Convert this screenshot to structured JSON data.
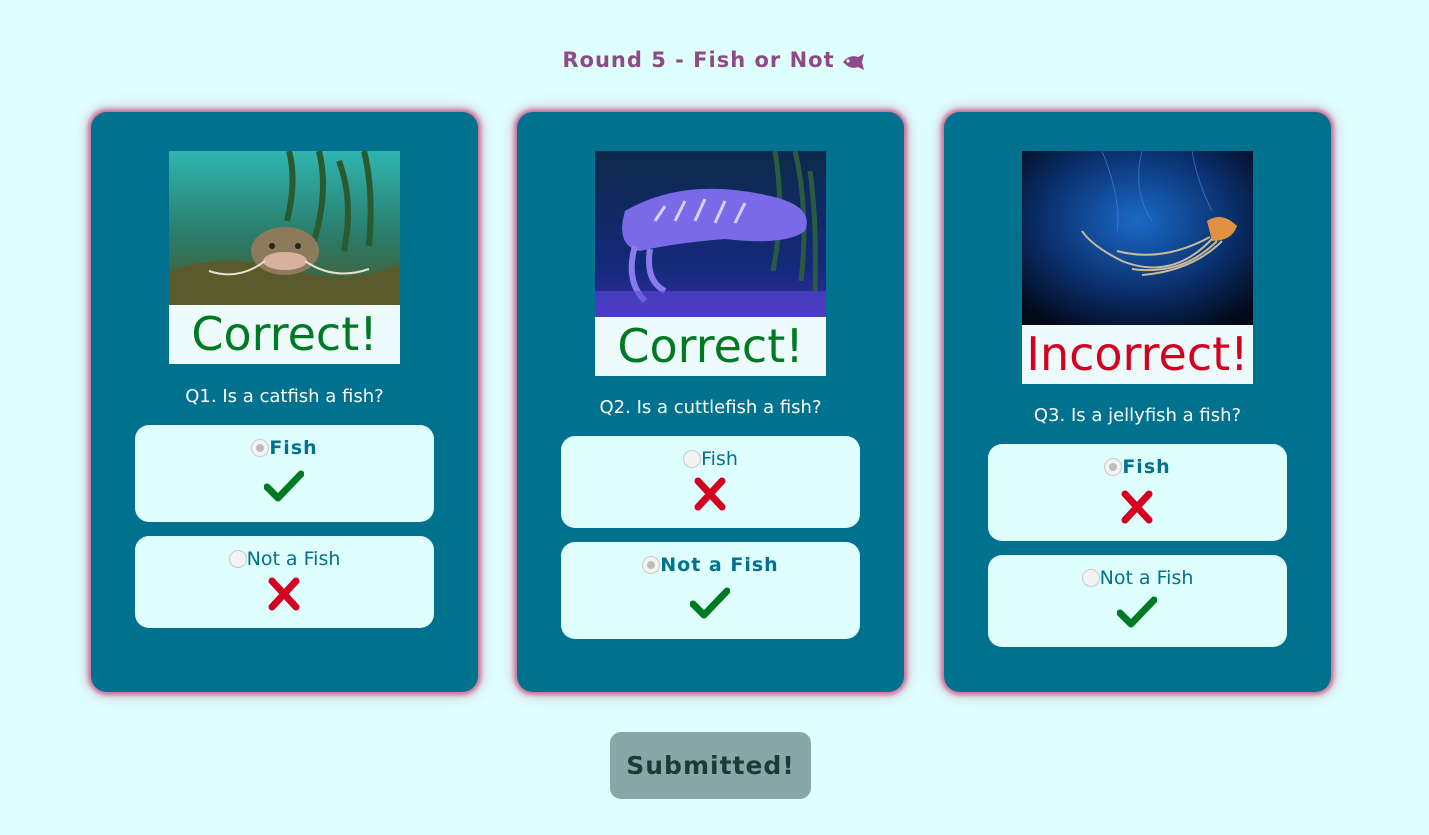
{
  "title": "Round 5 - Fish or Not",
  "submit_label": "Submitted!",
  "colors": {
    "background": "#dfffff",
    "card": "#00718e",
    "correct": "#007a22",
    "incorrect": "#d40020",
    "title": "#8e4a86"
  },
  "questions": [
    {
      "image": "catfish underwater photo",
      "result": "Correct!",
      "question": "Q1. Is a catfish a fish?",
      "options": [
        {
          "label": "Fish",
          "selected": true,
          "mark": "check-icon"
        },
        {
          "label": "Not a Fish",
          "selected": false,
          "mark": "cross-icon"
        }
      ]
    },
    {
      "image": "cuttlefish photo",
      "result": "Correct!",
      "question": "Q2. Is a cuttlefish a fish?",
      "options": [
        {
          "label": "Fish",
          "selected": false,
          "mark": "cross-icon"
        },
        {
          "label": "Not a Fish",
          "selected": true,
          "mark": "check-icon"
        }
      ]
    },
    {
      "image": "jellyfish photo",
      "result": "Incorrect!",
      "question": "Q3. Is a jellyfish a fish?",
      "options": [
        {
          "label": "Fish",
          "selected": true,
          "mark": "cross-icon"
        },
        {
          "label": "Not a Fish",
          "selected": false,
          "mark": "check-icon"
        }
      ]
    }
  ]
}
